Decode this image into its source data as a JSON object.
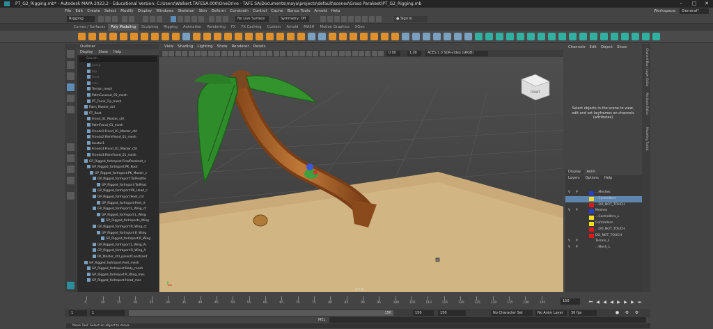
{
  "window": {
    "title": "PT_G2_Rigging.mb* - Autodesk MAYA 2023.2 - Educational Version: C:\\Users\\Walkert.TAFESA.000\\OneDrive - TAFE SA\\Documents\\maya\\projects\\default\\scenes\\Grass Parakeet\\PT_G2_Rigging.mb",
    "minimize": "–",
    "maximize": "□",
    "close": "✕"
  },
  "menu": {
    "items": [
      "File",
      "Edit",
      "Create",
      "Select",
      "Modify",
      "Display",
      "Windows",
      "Skeleton",
      "Skin",
      "Deform",
      "Constrain",
      "Control",
      "Cache",
      "Bonus Tools",
      "Arnold",
      "Help"
    ],
    "workspace_label": "Workspace:",
    "workspace_value": "General*"
  },
  "status": {
    "menuset": "Rigging",
    "live_surface": "No Live Surface",
    "symmetry": "Symmetry: Off",
    "sign_in": "Sign In"
  },
  "shelf": {
    "tabs": [
      "Curves / Surfaces",
      "Poly Modeling",
      "Sculpting",
      "Rigging",
      "Animation",
      "Rendering",
      "FX",
      "FX Caching",
      "Custom",
      "Arnold",
      "MASH",
      "Motion Graphics",
      "XGen"
    ],
    "active": "Poly Modeling"
  },
  "outliner": {
    "title": "Outliner",
    "menu": [
      "Display",
      "Show",
      "Help"
    ],
    "search_placeholder": "Search...",
    "rows": [
      {
        "label": "persp",
        "dim": true
      },
      {
        "label": "top",
        "dim": true
      },
      {
        "label": "front",
        "dim": true
      },
      {
        "label": "side",
        "dim": true
      },
      {
        "label": "Terrain_mesh",
        "dim": false
      },
      {
        "label": "PalmCoconut_01_mesh",
        "dim": false
      },
      {
        "label": "PT_Trunk_Tip_mesh",
        "dim": false
      },
      {
        "label": "Palm_Master_ctrl",
        "dim": false
      },
      {
        "label": "PT_Root",
        "dim": false
      },
      {
        "label": "Frond_01_Master_ctrl",
        "dim": false
      },
      {
        "label": "PalmFrond_01_mesh",
        "dim": false
      },
      {
        "label": "Fronds2:Frond_01_Master_ctrl",
        "dim": false
      },
      {
        "label": "Fronds2:PalmFrond_01_mesh",
        "dim": false
      },
      {
        "label": "locator1",
        "dim": false
      },
      {
        "label": "Fronds3:Frond_01_Master_ctrl",
        "dim": false
      },
      {
        "label": "Fronds3:PalmFrond_01_mesh",
        "dim": false
      },
      {
        "label": "GP_Rigged_forImport:FinalParakeet_c",
        "dim": false
      },
      {
        "label": "GP_Rigged_forImport:PK_Root",
        "dim": false
      },
      {
        "label": "GP_Rigged_forImport:PK_Master_c",
        "dim": false
      },
      {
        "label": "GP_Rigged_forImport:TailFeathe",
        "dim": false
      },
      {
        "label": "GP_Rigged_forImport:TailFeat",
        "dim": false
      },
      {
        "label": "GP_Rigged_forImport:PK_Head_c",
        "dim": false
      },
      {
        "label": "GP_Rigged_forImport:Feet_ctrl",
        "dim": false
      },
      {
        "label": "GP_Rigged_forImport:Feet_rt",
        "dim": false
      },
      {
        "label": "GP_Rigged_forImport:L_Wing_ct",
        "dim": false
      },
      {
        "label": "GP_Rigged_forImport:L_Wing",
        "dim": false
      },
      {
        "label": "GP_Rigged_forImports_Wing",
        "dim": false
      },
      {
        "label": "GP_Rigged_forImport:R_Wing_ct",
        "dim": false
      },
      {
        "label": "GP_Rigged_forImport:R_Wing",
        "dim": false
      },
      {
        "label": "GP_Rigged_forImport:R_Wing",
        "dim": false
      },
      {
        "label": "GP_Rigged_forImport:L_Wing_Ai",
        "dim": false
      },
      {
        "label": "GP_Rigged_forImport:R_Wing_A",
        "dim": false
      },
      {
        "label": "PK_Master_ctrl_parentConstraint",
        "dim": false
      },
      {
        "label": "GP_Rigged_forImport:Feet_mesh",
        "dim": false
      },
      {
        "label": "GP_Rigged_forImport:Body_mesh",
        "dim": false
      },
      {
        "label": "GP_Rigged_forImport:R_Wing_mes",
        "dim": false
      },
      {
        "label": "GP_Rigged_forImport:Head_mes",
        "dim": false
      }
    ]
  },
  "viewport": {
    "menu": [
      "View",
      "Shading",
      "Lighting",
      "Show",
      "Renderer",
      "Panels"
    ],
    "exposure": "0.00",
    "gamma": "1.00",
    "colorspace": "ACES 1.0 SDR-video (sRGB)",
    "camera_label": "persp",
    "cube_label": "FRONT"
  },
  "channel_box": {
    "menu": [
      "Channels",
      "Edit",
      "Object",
      "Show"
    ],
    "hint": "Select objects in the scene to view, edit and set keyframes on channels (attributes)"
  },
  "layers": {
    "tabs": [
      "Display",
      "Anim"
    ],
    "menu": [
      "Layers",
      "Options",
      "Help"
    ],
    "rows": [
      {
        "v": "V",
        "p": "P",
        "color": "#2a3ec8",
        "name": "...Meshes",
        "sel": false
      },
      {
        "v": "",
        "p": "",
        "color": "#f0e020",
        "name": "...Controllers",
        "sel": true
      },
      {
        "v": "",
        "p": "",
        "color": "#e01818",
        "name": "...DO_NOT_TOUCH",
        "sel": false
      },
      {
        "v": "V",
        "p": "P",
        "color": "#2a3ec8",
        "name": "Meshes",
        "sel": false
      },
      {
        "v": "",
        "p": "",
        "color": "#f0e020",
        "name": "...Controllers_L",
        "sel": false
      },
      {
        "v": "",
        "p": "",
        "color": "#f0e020",
        "name": "Controllers",
        "sel": false
      },
      {
        "v": "",
        "p": "",
        "color": "#e01818",
        "name": "...DO_NOT_TOUCH",
        "sel": false
      },
      {
        "v": "",
        "p": "",
        "color": "#e01818",
        "name": "DO_NOT_TOUCH",
        "sel": false
      },
      {
        "v": "V",
        "p": "P",
        "color": "",
        "name": "Terrain_L",
        "sel": false
      },
      {
        "v": "V",
        "p": "P",
        "color": "",
        "name": "...Mesh_L",
        "sel": false
      }
    ]
  },
  "side_tabs": [
    "Channel Box / Layer Editor",
    "Attribute Editor",
    "Modeling Toolkit"
  ],
  "timeline": {
    "ticks": [
      "5",
      "10",
      "15",
      "20",
      "25",
      "30",
      "35",
      "40",
      "45",
      "50",
      "55",
      "60",
      "65",
      "70",
      "75",
      "80",
      "85",
      "90",
      "95",
      "100",
      "105",
      "110",
      "115",
      "120",
      "125",
      "130",
      "135",
      "140",
      "145"
    ],
    "current_frame": "150"
  },
  "range": {
    "start": "1",
    "start2": "1",
    "slider_end": "150",
    "end": "150",
    "end2": "150",
    "character_set": "No Character Set",
    "anim_layer": "No Anim Layer",
    "fps": "30 fps"
  },
  "command": {
    "lang": "MEL",
    "help": "Move Tool: Select an object to move."
  }
}
